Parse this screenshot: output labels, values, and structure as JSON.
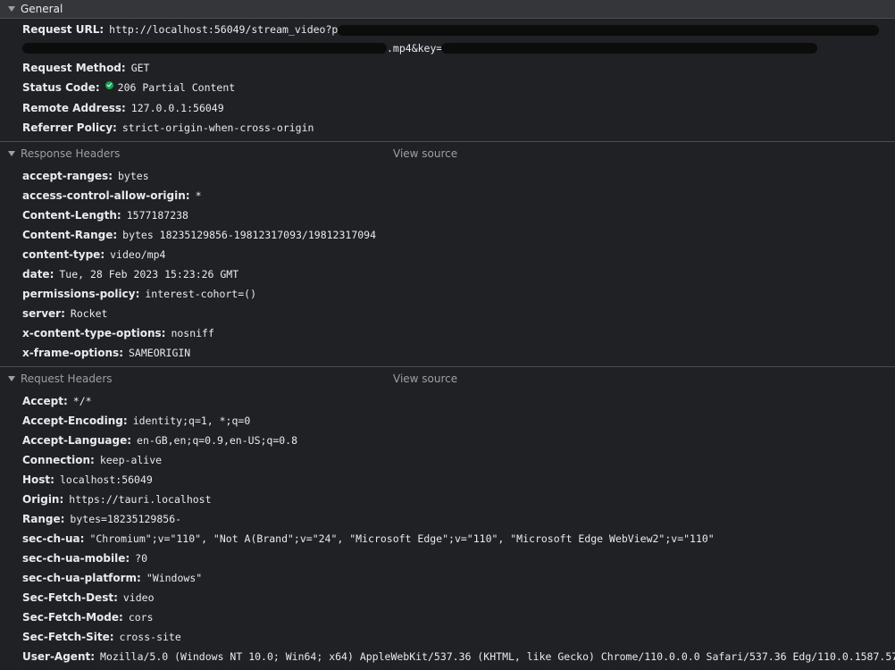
{
  "general": {
    "title": "General",
    "request_url_label": "Request URL:",
    "request_url_value": "http://localhost:56049/stream_video?path=",
    "request_url_cont": ".mp4&key=",
    "request_method_label": "Request Method:",
    "request_method_value": "GET",
    "status_code_label": "Status Code:",
    "status_code_value": "206 Partial Content",
    "status_color": "#0fa851",
    "remote_address_label": "Remote Address:",
    "remote_address_value": "127.0.0.1:56049",
    "referrer_policy_label": "Referrer Policy:",
    "referrer_policy_value": "strict-origin-when-cross-origin"
  },
  "response_headers": {
    "title": "Response Headers",
    "view_source": "View source",
    "items": [
      {
        "key": "accept-ranges:",
        "value": "bytes"
      },
      {
        "key": "access-control-allow-origin:",
        "value": "*"
      },
      {
        "key": "Content-Length:",
        "value": "1577187238"
      },
      {
        "key": "Content-Range:",
        "value": "bytes 18235129856-19812317093/19812317094"
      },
      {
        "key": "content-type:",
        "value": "video/mp4"
      },
      {
        "key": "date:",
        "value": "Tue, 28 Feb 2023 15:23:26 GMT"
      },
      {
        "key": "permissions-policy:",
        "value": "interest-cohort=()"
      },
      {
        "key": "server:",
        "value": "Rocket"
      },
      {
        "key": "x-content-type-options:",
        "value": "nosniff"
      },
      {
        "key": "x-frame-options:",
        "value": "SAMEORIGIN"
      }
    ]
  },
  "request_headers": {
    "title": "Request Headers",
    "view_source": "View source",
    "items": [
      {
        "key": "Accept:",
        "value": "*/*"
      },
      {
        "key": "Accept-Encoding:",
        "value": "identity;q=1, *;q=0"
      },
      {
        "key": "Accept-Language:",
        "value": "en-GB,en;q=0.9,en-US;q=0.8"
      },
      {
        "key": "Connection:",
        "value": "keep-alive"
      },
      {
        "key": "Host:",
        "value": "localhost:56049"
      },
      {
        "key": "Origin:",
        "value": "https://tauri.localhost"
      },
      {
        "key": "Range:",
        "value": "bytes=18235129856-"
      },
      {
        "key": "sec-ch-ua:",
        "value": "\"Chromium\";v=\"110\", \"Not A(Brand\";v=\"24\", \"Microsoft Edge\";v=\"110\", \"Microsoft Edge WebView2\";v=\"110\""
      },
      {
        "key": "sec-ch-ua-mobile:",
        "value": "?0"
      },
      {
        "key": "sec-ch-ua-platform:",
        "value": "\"Windows\""
      },
      {
        "key": "Sec-Fetch-Dest:",
        "value": "video"
      },
      {
        "key": "Sec-Fetch-Mode:",
        "value": "cors"
      },
      {
        "key": "Sec-Fetch-Site:",
        "value": "cross-site"
      },
      {
        "key": "User-Agent:",
        "value": "Mozilla/5.0 (Windows NT 10.0; Win64; x64) AppleWebKit/537.36 (KHTML, like Gecko) Chrome/110.0.0.0 Safari/537.36 Edg/110.0.1587.57"
      }
    ]
  }
}
